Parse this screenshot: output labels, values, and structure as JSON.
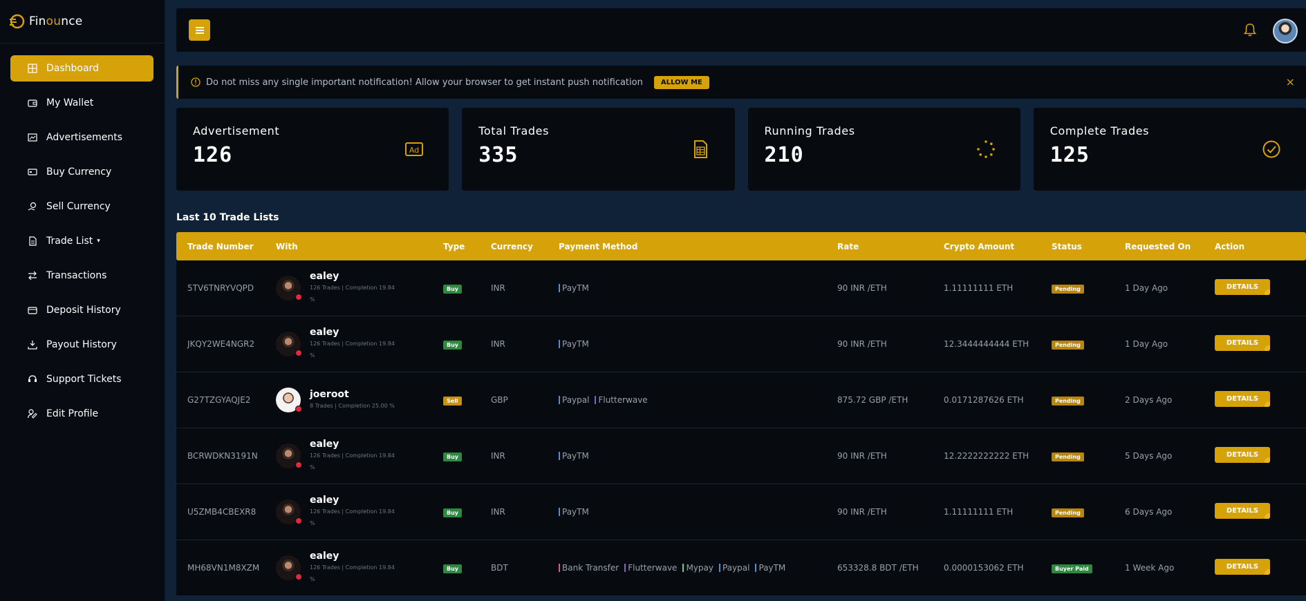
{
  "brand": {
    "name_prefix": "Fin",
    "name_accent": "ou",
    "name_suffix": "nce"
  },
  "sidebar": {
    "items": [
      {
        "label": "Dashboard",
        "icon": "dashboard-icon",
        "active": true
      },
      {
        "label": "My Wallet",
        "icon": "wallet-icon"
      },
      {
        "label": "Advertisements",
        "icon": "advertisements-icon"
      },
      {
        "label": "Buy Currency",
        "icon": "buy-currency-icon"
      },
      {
        "label": "Sell Currency",
        "icon": "sell-currency-icon"
      },
      {
        "label": "Trade List",
        "icon": "trade-list-icon",
        "dropdown": true
      },
      {
        "label": "Transactions",
        "icon": "transactions-icon"
      },
      {
        "label": "Deposit History",
        "icon": "deposit-history-icon"
      },
      {
        "label": "Payout History",
        "icon": "payout-history-icon"
      },
      {
        "label": "Support Tickets",
        "icon": "support-tickets-icon"
      },
      {
        "label": "Edit Profile",
        "icon": "edit-profile-icon"
      }
    ]
  },
  "alert": {
    "text": "Do not miss any single important notification! Allow your browser to get instant push notification",
    "button": "ALLOW ME",
    "close": "×"
  },
  "stats": [
    {
      "title": "Advertisement",
      "value": "126",
      "icon": "ad-icon"
    },
    {
      "title": "Total Trades",
      "value": "335",
      "icon": "document-icon"
    },
    {
      "title": "Running Trades",
      "value": "210",
      "icon": "spinner-icon"
    },
    {
      "title": "Complete Trades",
      "value": "125",
      "icon": "check-circle-icon"
    }
  ],
  "table": {
    "title": "Last 10 Trade Lists",
    "headers": [
      "Trade Number",
      "With",
      "Type",
      "Currency",
      "Payment Method",
      "Rate",
      "Crypto Amount",
      "Status",
      "Requested On",
      "Action"
    ],
    "rows": [
      {
        "number": "5TV6TNRYVQPD",
        "user": "ealey",
        "meta": "126 Trades | Completion 19.84 %",
        "type": "Buy",
        "currency": "INR",
        "payments": [
          "PayTM"
        ],
        "rate": "90 INR /ETH",
        "amount": "1.11111111 ETH",
        "status": "Pending",
        "requested": "1 Day Ago",
        "action": "DETAILS"
      },
      {
        "number": "JKQY2WE4NGR2",
        "user": "ealey",
        "meta": "126 Trades | Completion 19.84 %",
        "type": "Buy",
        "currency": "INR",
        "payments": [
          "PayTM"
        ],
        "rate": "90 INR /ETH",
        "amount": "12.3444444444 ETH",
        "status": "Pending",
        "requested": "1 Day Ago",
        "action": "DETAILS"
      },
      {
        "number": "G27TZGYAQJE2",
        "user": "joeroot",
        "meta": "8 Trades | Completion 25.00 %",
        "type": "Sell",
        "currency": "GBP",
        "payments": [
          "Paypal",
          "Flutterwave"
        ],
        "rate": "875.72 GBP /ETH",
        "amount": "0.0171287626 ETH",
        "status": "Pending",
        "requested": "2 Days Ago",
        "action": "DETAILS"
      },
      {
        "number": "BCRWDKN3191N",
        "user": "ealey",
        "meta": "126 Trades | Completion 19.84 %",
        "type": "Buy",
        "currency": "INR",
        "payments": [
          "PayTM"
        ],
        "rate": "90 INR /ETH",
        "amount": "12.2222222222 ETH",
        "status": "Pending",
        "requested": "5 Days Ago",
        "action": "DETAILS"
      },
      {
        "number": "U5ZMB4CBEXR8",
        "user": "ealey",
        "meta": "126 Trades | Completion 19.84 %",
        "type": "Buy",
        "currency": "INR",
        "payments": [
          "PayTM"
        ],
        "rate": "90 INR /ETH",
        "amount": "1.11111111 ETH",
        "status": "Pending",
        "requested": "6 Days Ago",
        "action": "DETAILS"
      },
      {
        "number": "MH68VN1M8XZM",
        "user": "ealey",
        "meta": "126 Trades | Completion 19.84 %",
        "type": "Buy",
        "currency": "BDT",
        "payments": [
          "Bank Transfer",
          "Flutterwave",
          "Mypay",
          "Paypal",
          "PayTM"
        ],
        "rate": "653328.8 BDT /ETH",
        "amount": "0.0000153062 ETH",
        "status": "Buyer Paid",
        "requested": "1 Week Ago",
        "action": "DETAILS"
      }
    ]
  },
  "colors": {
    "accent": "#d6a20a",
    "background": "#0f2238",
    "panel": "#070b10",
    "buy": "#2b8a3e",
    "danger": "#e0293a"
  }
}
